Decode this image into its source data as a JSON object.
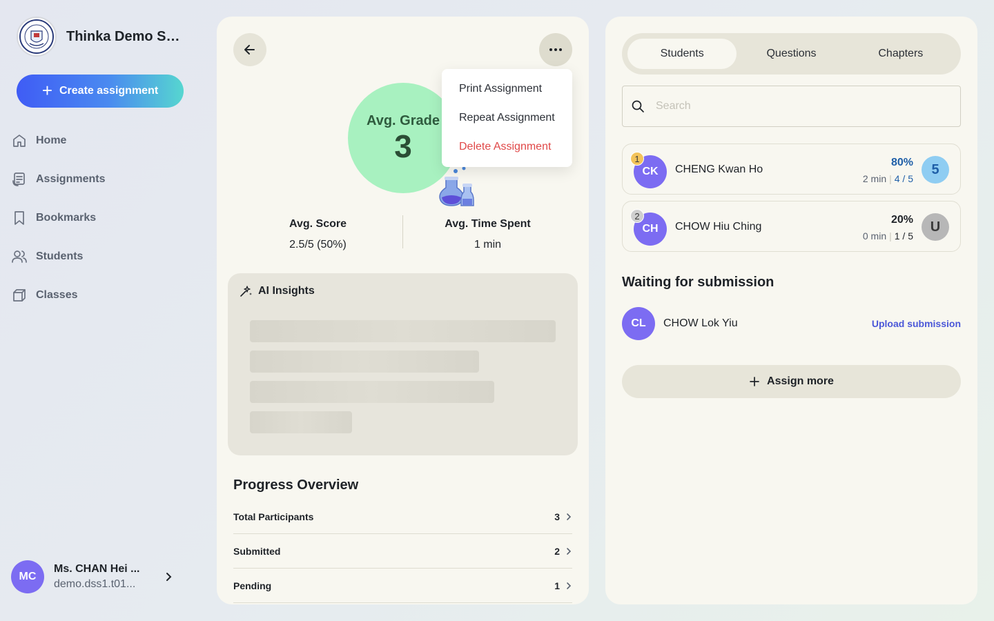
{
  "sidebar": {
    "school_name": "Thinka Demo Se...",
    "create_label": "Create assignment",
    "nav": [
      {
        "label": "Home",
        "icon": "home-icon"
      },
      {
        "label": "Assignments",
        "icon": "assignments-icon"
      },
      {
        "label": "Bookmarks",
        "icon": "bookmark-icon"
      },
      {
        "label": "Students",
        "icon": "students-icon"
      },
      {
        "label": "Classes",
        "icon": "classes-icon"
      }
    ],
    "user": {
      "initials": "MC",
      "name": "Ms. CHAN Hei ...",
      "email": "demo.dss1.t01..."
    }
  },
  "assignment": {
    "grade_label": "Avg. Grade",
    "grade_value": "3",
    "menu": {
      "print": "Print Assignment",
      "repeat": "Repeat Assignment",
      "delete": "Delete Assignment"
    },
    "stats": {
      "score_label": "Avg. Score",
      "score_value": "2.5/5 (50%)",
      "time_label": "Avg. Time Spent",
      "time_value": "1 min"
    },
    "insights_title": "AI Insights",
    "progress": {
      "title": "Progress Overview",
      "rows": [
        {
          "label": "Total Participants",
          "value": "3"
        },
        {
          "label": "Submitted",
          "value": "2"
        },
        {
          "label": "Pending",
          "value": "1"
        }
      ]
    }
  },
  "students_panel": {
    "tabs": [
      "Students",
      "Questions",
      "Chapters"
    ],
    "active_tab": "Students",
    "search_placeholder": "Search",
    "students": [
      {
        "rank": "1",
        "initials": "CK",
        "name": "CHENG Kwan Ho",
        "percent": "80%",
        "time": "2 min",
        "score": "4 / 5",
        "grade": "5",
        "percent_color": "#1f5fa8",
        "badge_bg": "#8fcdf2",
        "badge_color": "#1f5fa8"
      },
      {
        "rank": "2",
        "initials": "CH",
        "name": "CHOW Hiu Ching",
        "percent": "20%",
        "time": "0 min",
        "score": "1 / 5",
        "grade": "U",
        "percent_color": "#1f2328",
        "badge_bg": "#b7b7b7",
        "badge_color": "#3a3a3a"
      }
    ],
    "waiting_title": "Waiting for submission",
    "waiting": [
      {
        "initials": "CL",
        "name": "CHOW Lok Yiu",
        "action": "Upload submission"
      }
    ],
    "assign_more_label": "Assign more"
  }
}
